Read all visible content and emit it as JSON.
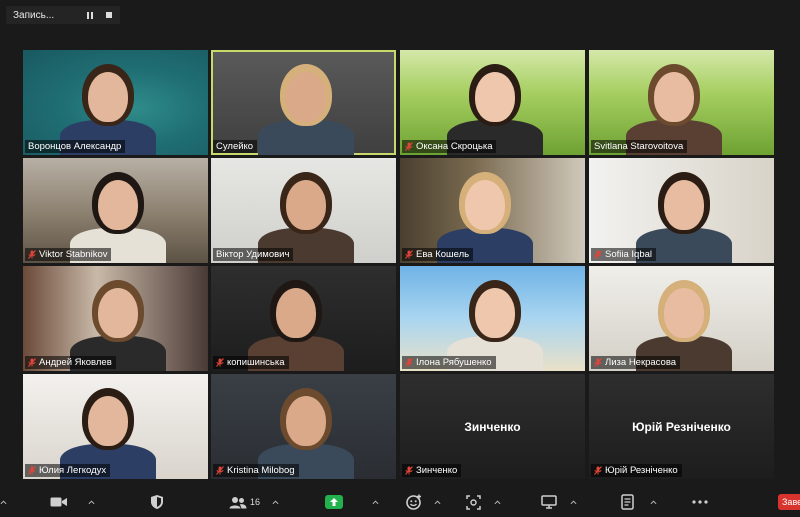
{
  "recording": {
    "label": "Запись..."
  },
  "tiles": [
    {
      "name": "Воронцов Александр",
      "muted": false,
      "bg": "bg-sea"
    },
    {
      "name": "Сулейко",
      "muted": false,
      "bg": "bg-grey",
      "active": true
    },
    {
      "name": "Оксана Скроцька",
      "muted": true,
      "bg": "bg-grass"
    },
    {
      "name": "Svitlana Starovoitova",
      "muted": false,
      "bg": "bg-grass"
    },
    {
      "name": "Viktor Stabnikov",
      "muted": true,
      "bg": "bg-field"
    },
    {
      "name": "Віктор Удимович",
      "muted": false,
      "bg": "bg-wall"
    },
    {
      "name": "Ева Кошель",
      "muted": true,
      "bg": "bg-room"
    },
    {
      "name": "Sofiia Iqbal",
      "muted": true,
      "bg": "bg-curtain"
    },
    {
      "name": "Андрей Яковлев",
      "muted": true,
      "bg": "bg-window"
    },
    {
      "name": "копишинська",
      "muted": true,
      "bg": "bg-dark"
    },
    {
      "name": "Ілона Рябушенко",
      "muted": true,
      "bg": "bg-beach"
    },
    {
      "name": "Лиза Некрасова",
      "muted": true,
      "bg": "bg-bright"
    },
    {
      "name": "Юлия Легкодух",
      "muted": true,
      "bg": "bg-white"
    },
    {
      "name": "Kristina Milobog",
      "muted": true,
      "bg": "bg-studio"
    },
    {
      "name": "Зинченко",
      "muted": true,
      "bg": "bg-dark",
      "no_video": true,
      "center_label": "Зинченко"
    },
    {
      "name": "Юрій Резніченко",
      "muted": true,
      "bg": "bg-dark",
      "no_video": true,
      "center_label": "Юрій Резніченко"
    }
  ],
  "toolbar": {
    "participants_count": "16",
    "end_label": "Заве"
  },
  "colors": {
    "active_speaker": "#c9d86a",
    "muted_red": "#e0443a",
    "share_green": "#22b14c",
    "end_red": "#d9332e"
  }
}
